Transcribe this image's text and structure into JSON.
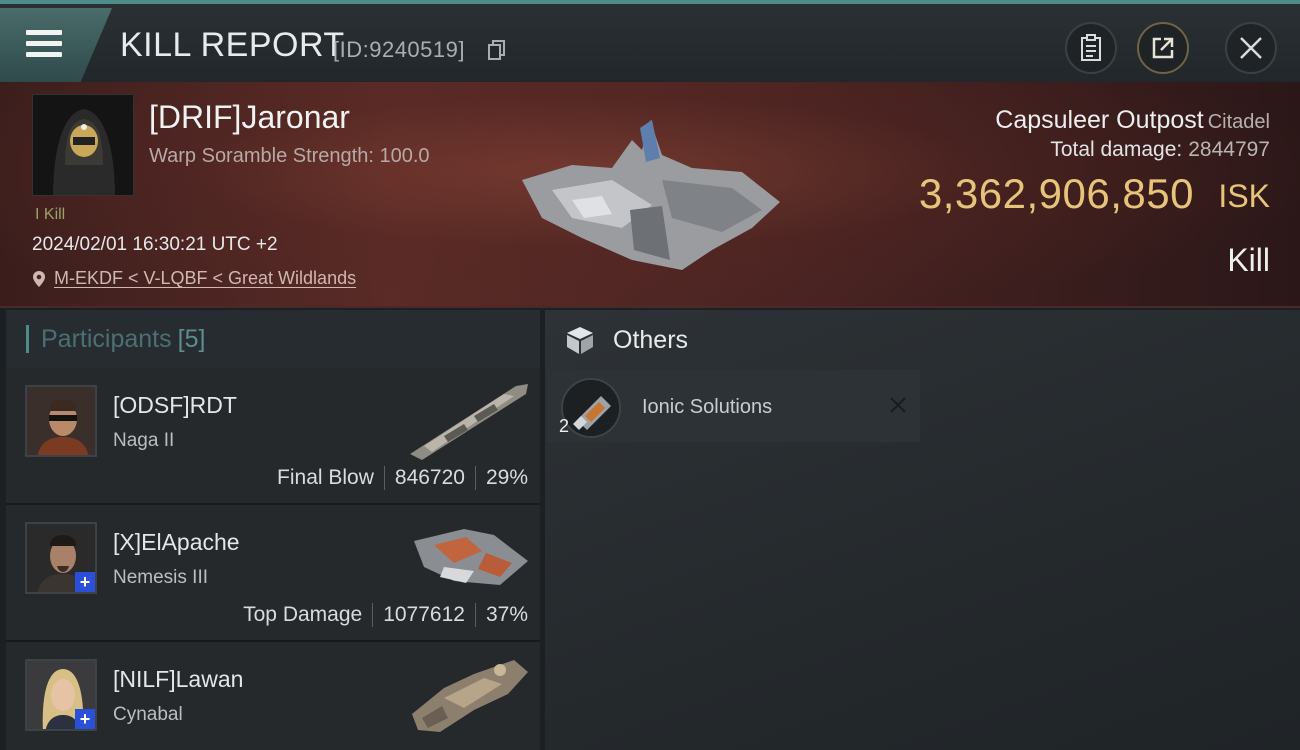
{
  "header": {
    "title": "KILL REPORT",
    "report_id": "[ID:9240519]"
  },
  "icons": {
    "menu": "hamburger-menu-icon",
    "copy": "copy-icon",
    "clipboard": "clipboard-icon",
    "share": "share-icon",
    "close": "close-icon",
    "location": "map-pin-icon",
    "others": "cube-icon"
  },
  "colors": {
    "accent": "#4f8d88",
    "isk": "#e6c47a",
    "victim_bg": "#5a2b27"
  },
  "victim": {
    "name": "[DRIF]Jaronar",
    "warp_scramble": "Warp Soramble Strength: 100.0",
    "kill_tag": "I Kill",
    "timestamp": "2024/02/01 16:30:21 UTC +2",
    "location": "M-EKDF < V-LQBF < Great Wildlands",
    "structure_name": "Capsuleer Outpost",
    "structure_type": "Citadel",
    "total_damage_label": "Total damage:",
    "total_damage_value": "2844797",
    "isk_value": "3,362,906,850",
    "isk_unit": "ISK",
    "result": "Kill"
  },
  "participants": {
    "label": "Participants",
    "count": "[5]",
    "items": [
      {
        "name": "[ODSF]RDT",
        "ship": "Naga II",
        "role": "Final Blow",
        "damage": "846720",
        "percent": "29%",
        "has_plus": false
      },
      {
        "name": "[X]ElApache",
        "ship": "Nemesis III",
        "role": "Top Damage",
        "damage": "1077612",
        "percent": "37%",
        "has_plus": true
      },
      {
        "name": "[NILF]Lawan",
        "ship": "Cynabal",
        "role": "",
        "damage": "",
        "percent": "",
        "has_plus": true
      }
    ]
  },
  "others": {
    "title": "Others",
    "items": [
      {
        "name": "Ionic Solutions",
        "quantity": "2"
      }
    ]
  }
}
